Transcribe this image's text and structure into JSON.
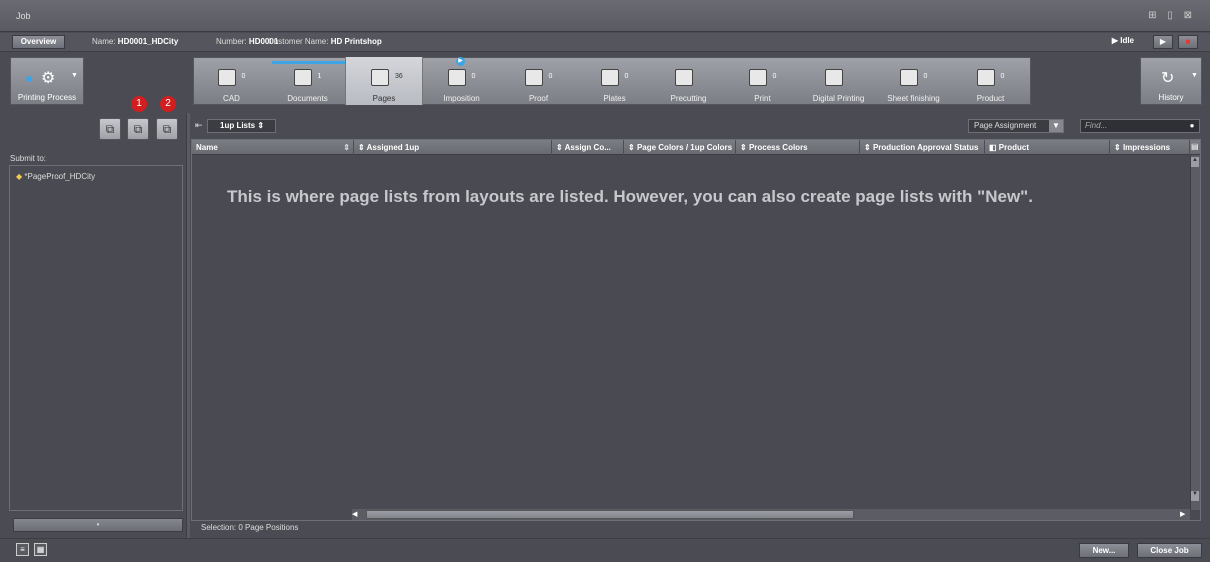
{
  "window": {
    "title": "Job",
    "controls": "⊞ ▯ ⊠"
  },
  "infobar": {
    "overview_label": "Overview",
    "name_label": "Name:",
    "name_value": "HD0001_HDCity",
    "number_label": "Number:",
    "number_value": "HD0001",
    "customer_label": "Customer Name:",
    "customer_value": "HD Printshop",
    "status": "Idle"
  },
  "left_buttons": {
    "printing_process": "Printing Process",
    "history": "History"
  },
  "process_steps": [
    {
      "label": "CAD",
      "count": "0",
      "icon": "cad-icon"
    },
    {
      "label": "Documents",
      "count": "1",
      "icon": "documents-icon"
    },
    {
      "label": "Pages",
      "count": "36",
      "icon": "pages-icon"
    },
    {
      "label": "Imposition",
      "count": "0",
      "icon": "imposition-icon"
    },
    {
      "label": "Proof",
      "count": "0",
      "icon": "proof-icon"
    },
    {
      "label": "Plates",
      "count": "0",
      "icon": "plates-icon"
    },
    {
      "label": "Precutting",
      "count": "",
      "icon": "precutting-icon"
    },
    {
      "label": "Print",
      "count": "0",
      "icon": "print-icon"
    },
    {
      "label": "Digital Printing",
      "count": "",
      "icon": "digital-printing-icon"
    },
    {
      "label": "Sheet finishing",
      "count": "0",
      "icon": "sheet-finishing-icon"
    },
    {
      "label": "Product",
      "count": "0",
      "icon": "product-icon"
    }
  ],
  "badges": [
    "1",
    "2"
  ],
  "submit": {
    "label": "Submit to:",
    "items": [
      "*PageProof_HDCity"
    ],
    "bar_label": "•"
  },
  "toolbar": {
    "list_dropdown": "1up Lists",
    "page_assignment": "Page Assignment",
    "find_placeholder": "Find..."
  },
  "table": {
    "columns": [
      "Name",
      "Assigned 1up",
      "Assign Co...",
      "Page Colors / 1up Colors",
      "Process Colors",
      "Production Approval Status",
      "Product",
      "Impressions"
    ],
    "rows": [],
    "empty_message": "This is where page lists from layouts are listed. However, you can also create page lists with \"New\"."
  },
  "status": {
    "selection": "Selection:  0 Page Positions"
  },
  "footer": {
    "new_label": "New...",
    "close_label": "Close Job"
  }
}
